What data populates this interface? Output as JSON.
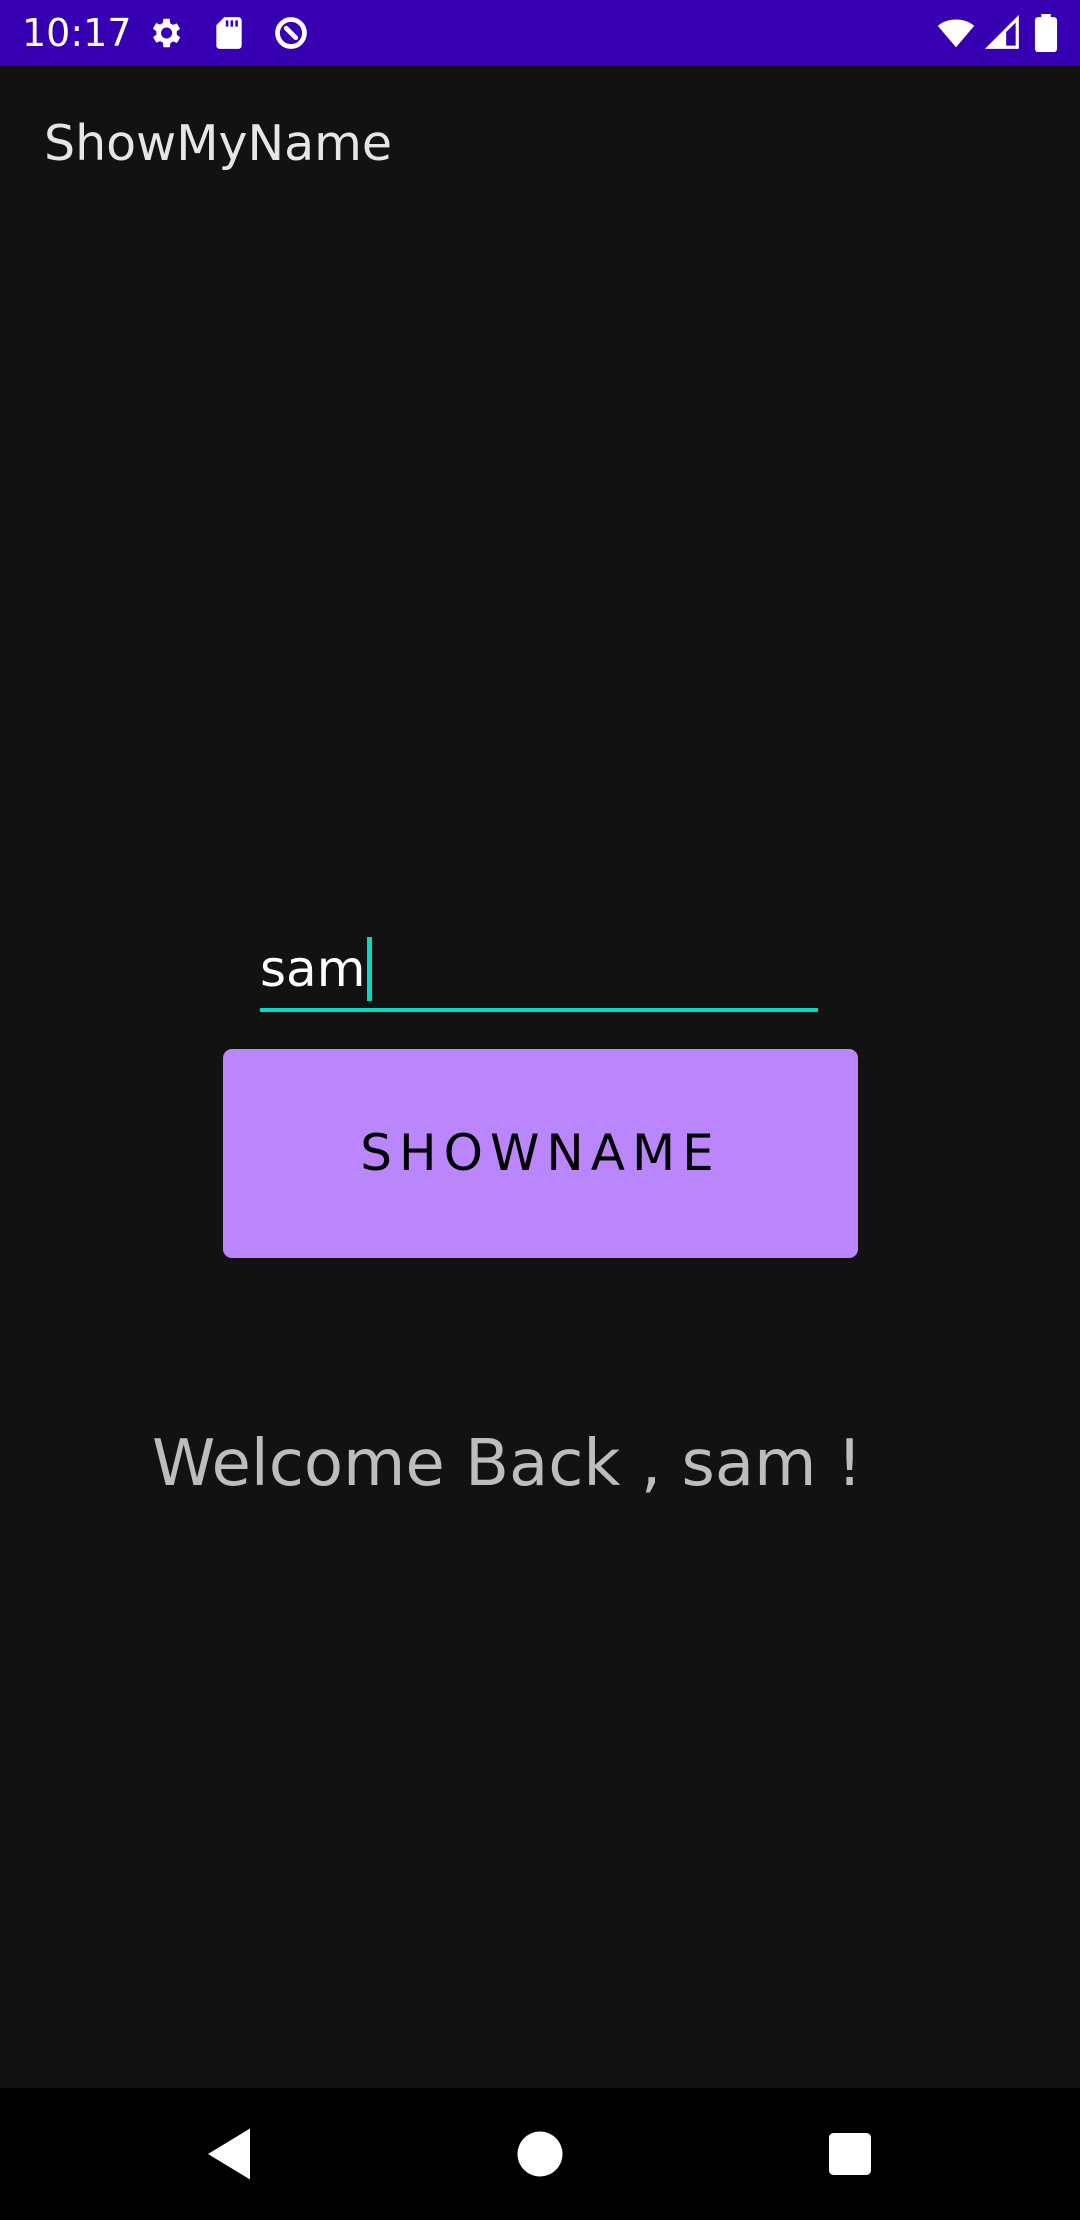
{
  "status_bar": {
    "time": "10:17",
    "color": "#3700B3",
    "left_icons": [
      "gear-icon",
      "sd-card-icon",
      "data-saver-icon"
    ],
    "right_icons": [
      "wifi-icon",
      "cell-signal-icon",
      "battery-icon"
    ]
  },
  "app_bar": {
    "title": "ShowMyName"
  },
  "form": {
    "name_value": "sam",
    "underline_color": "#03DAC5",
    "button_label": "SHOWNAME",
    "button_color": "#BB86FC"
  },
  "result": {
    "welcome_message": "Welcome Back , sam !"
  },
  "nav_bar": {
    "buttons": [
      "back-icon",
      "home-icon",
      "recents-icon"
    ]
  }
}
